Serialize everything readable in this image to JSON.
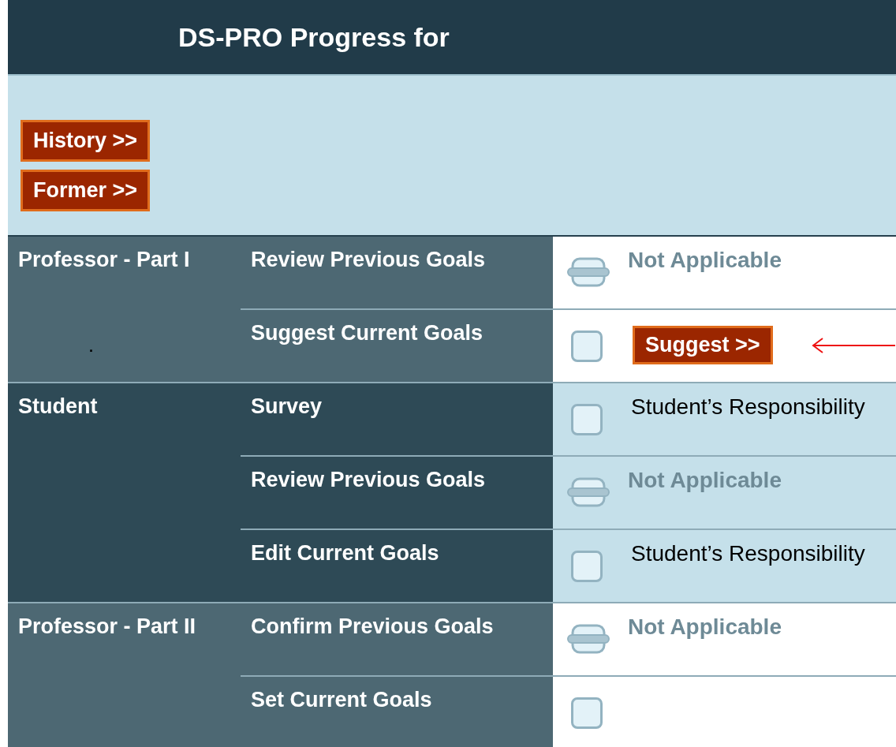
{
  "header": {
    "title": "DS-PRO Progress for"
  },
  "top_buttons": [
    "History >>",
    "Former >>"
  ],
  "groups": [
    {
      "role": "Professor - Part I",
      "kind": "professor",
      "note": ".",
      "steps": [
        {
          "label": "Review Previous Goals",
          "kind": "not-applicable",
          "status": "Not Applicable"
        },
        {
          "label": "Suggest Current Goals",
          "kind": "checkbox",
          "checked": false,
          "button": "Suggest >>",
          "pointer_arrow": true
        }
      ]
    },
    {
      "role": "Student",
      "kind": "student",
      "steps": [
        {
          "label": "Survey",
          "kind": "checkbox",
          "checked": false,
          "status": "Student’s Responsibility"
        },
        {
          "label": "Review Previous Goals",
          "kind": "not-applicable",
          "status": "Not Applicable"
        },
        {
          "label": "Edit Current Goals",
          "kind": "checkbox",
          "checked": false,
          "status": "Student’s Responsibility"
        }
      ]
    },
    {
      "role": "Professor - Part II",
      "kind": "professor",
      "steps": [
        {
          "label": "Confirm Previous Goals",
          "kind": "not-applicable",
          "status": "Not Applicable"
        },
        {
          "label": "Set Current Goals",
          "kind": "checkbox",
          "checked": false
        }
      ]
    }
  ]
}
